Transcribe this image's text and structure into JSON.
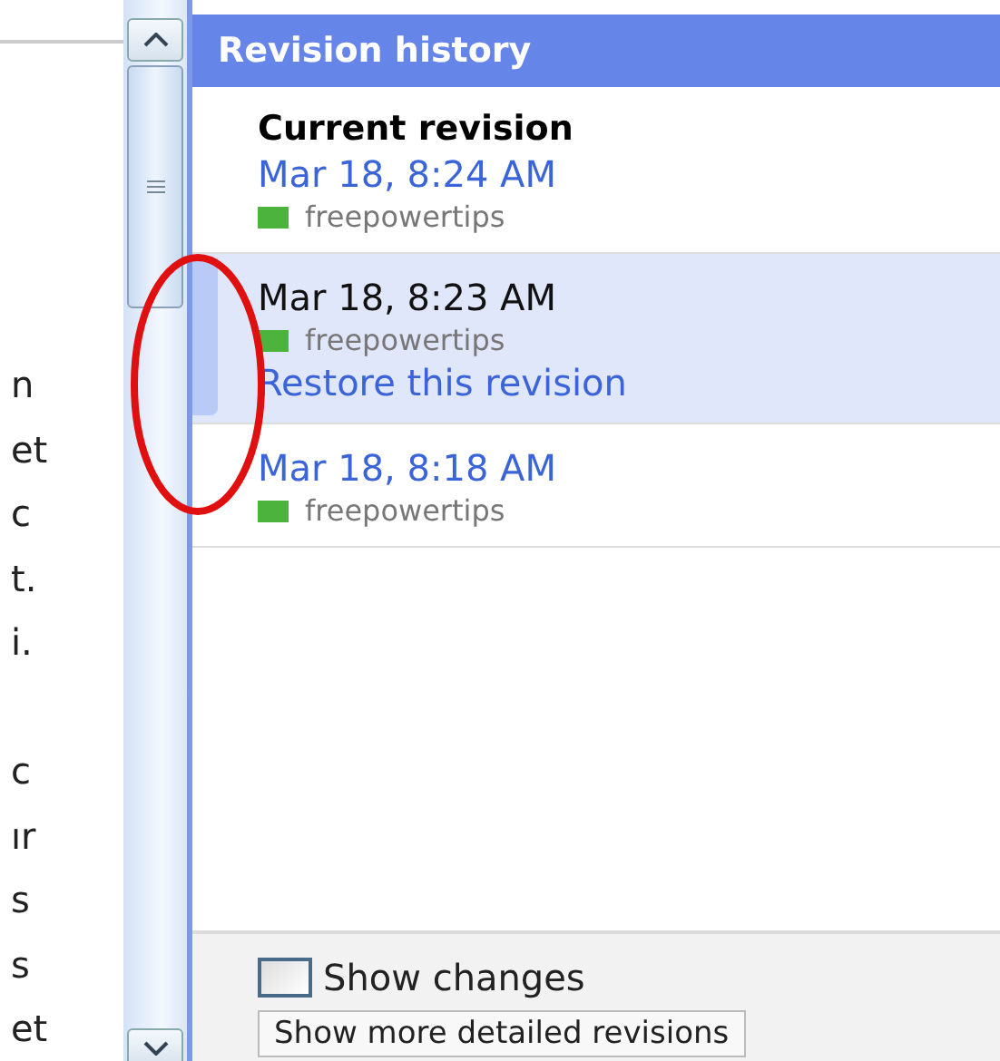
{
  "document": {
    "fragment_groups": [
      [
        "n",
        "et",
        "c",
        "t.",
        "i."
      ],
      [
        "c",
        "ır",
        "s",
        "s",
        "et"
      ]
    ]
  },
  "panel": {
    "title": "Revision history",
    "revisions": [
      {
        "heading": "Current revision",
        "date": "Mar 18, 8:24 AM",
        "author": "freepowertips",
        "color": "#4cb33c",
        "selected": false
      },
      {
        "date": "Mar 18, 8:23 AM",
        "author": "freepowertips",
        "color": "#4cb33c",
        "selected": true,
        "restore": "Restore this revision"
      },
      {
        "date": "Mar 18, 8:18 AM",
        "author": "freepowertips",
        "color": "#4cb33c",
        "selected": false
      }
    ],
    "show_changes": {
      "label": "Show changes",
      "checked": false
    },
    "button": "Show more detailed revisions"
  }
}
